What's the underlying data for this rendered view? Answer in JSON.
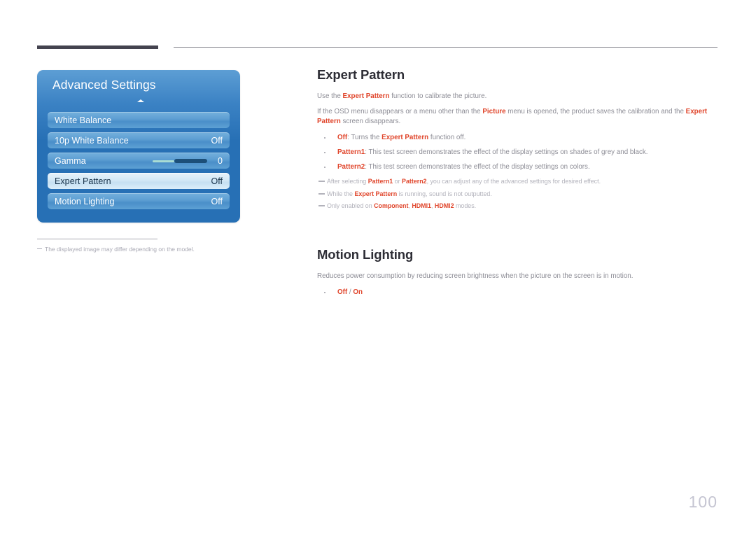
{
  "page": {
    "number": "100"
  },
  "osd": {
    "title": "Advanced Settings",
    "rows": [
      {
        "label": "White Balance",
        "value": "",
        "type": "plain",
        "selected": false
      },
      {
        "label": "10p White Balance",
        "value": "Off",
        "type": "plain",
        "selected": false
      },
      {
        "label": "Gamma",
        "value": "0",
        "type": "slider",
        "selected": false
      },
      {
        "label": "Expert Pattern",
        "value": "Off",
        "type": "plain",
        "selected": true
      },
      {
        "label": "Motion Lighting",
        "value": "Off",
        "type": "plain",
        "selected": false
      }
    ],
    "footnote": "The displayed image may differ depending on the model."
  },
  "sections": [
    {
      "title": "Expert Pattern",
      "paragraphs": [
        [
          {
            "t": "Use the ",
            "a": false
          },
          {
            "t": "Expert Pattern",
            "a": true
          },
          {
            "t": " function to calibrate the picture.",
            "a": false
          }
        ],
        [
          {
            "t": "If the OSD menu disappears or a menu other than the ",
            "a": false
          },
          {
            "t": "Picture",
            "a": true
          },
          {
            "t": " menu is opened, the product saves the calibration and the ",
            "a": false
          },
          {
            "t": "Expert Pattern",
            "a": true
          },
          {
            "t": " screen disappears.",
            "a": false
          }
        ]
      ],
      "bullets": [
        [
          {
            "t": "Off",
            "a": true
          },
          {
            "t": ": Turns the ",
            "a": false
          },
          {
            "t": "Expert Pattern",
            "a": true
          },
          {
            "t": " function off.",
            "a": false
          }
        ],
        [
          {
            "t": "Pattern1",
            "a": true
          },
          {
            "t": ": This test screen demonstrates the effect of the display settings on shades of grey and black.",
            "a": false
          }
        ],
        [
          {
            "t": "Pattern2",
            "a": true
          },
          {
            "t": ": This test screen demonstrates the effect of the display settings on colors.",
            "a": false
          }
        ]
      ],
      "notes": [
        [
          {
            "t": "After selecting ",
            "a": false
          },
          {
            "t": "Pattern1",
            "a": true
          },
          {
            "t": " or ",
            "a": false
          },
          {
            "t": "Pattern2",
            "a": true
          },
          {
            "t": ", you can adjust any of the advanced settings for desired effect.",
            "a": false
          }
        ],
        [
          {
            "t": "While the ",
            "a": false
          },
          {
            "t": "Expert Pattern",
            "a": true
          },
          {
            "t": " is running, sound is not outputted.",
            "a": false
          }
        ],
        [
          {
            "t": "Only enabled on ",
            "a": false
          },
          {
            "t": "Component",
            "a": true
          },
          {
            "t": ", ",
            "a": false
          },
          {
            "t": "HDMI1",
            "a": true
          },
          {
            "t": ", ",
            "a": false
          },
          {
            "t": "HDMI2",
            "a": true
          },
          {
            "t": " modes.",
            "a": false
          }
        ]
      ]
    },
    {
      "title": "Motion Lighting",
      "paragraphs": [
        [
          {
            "t": "Reduces power consumption by reducing screen brightness when the picture on the screen is in motion.",
            "a": false
          }
        ]
      ],
      "bullets": [
        [
          {
            "t": "Off",
            "a": true
          },
          {
            "t": " / ",
            "a": false
          },
          {
            "t": "On",
            "a": true
          }
        ]
      ],
      "notes": []
    }
  ]
}
